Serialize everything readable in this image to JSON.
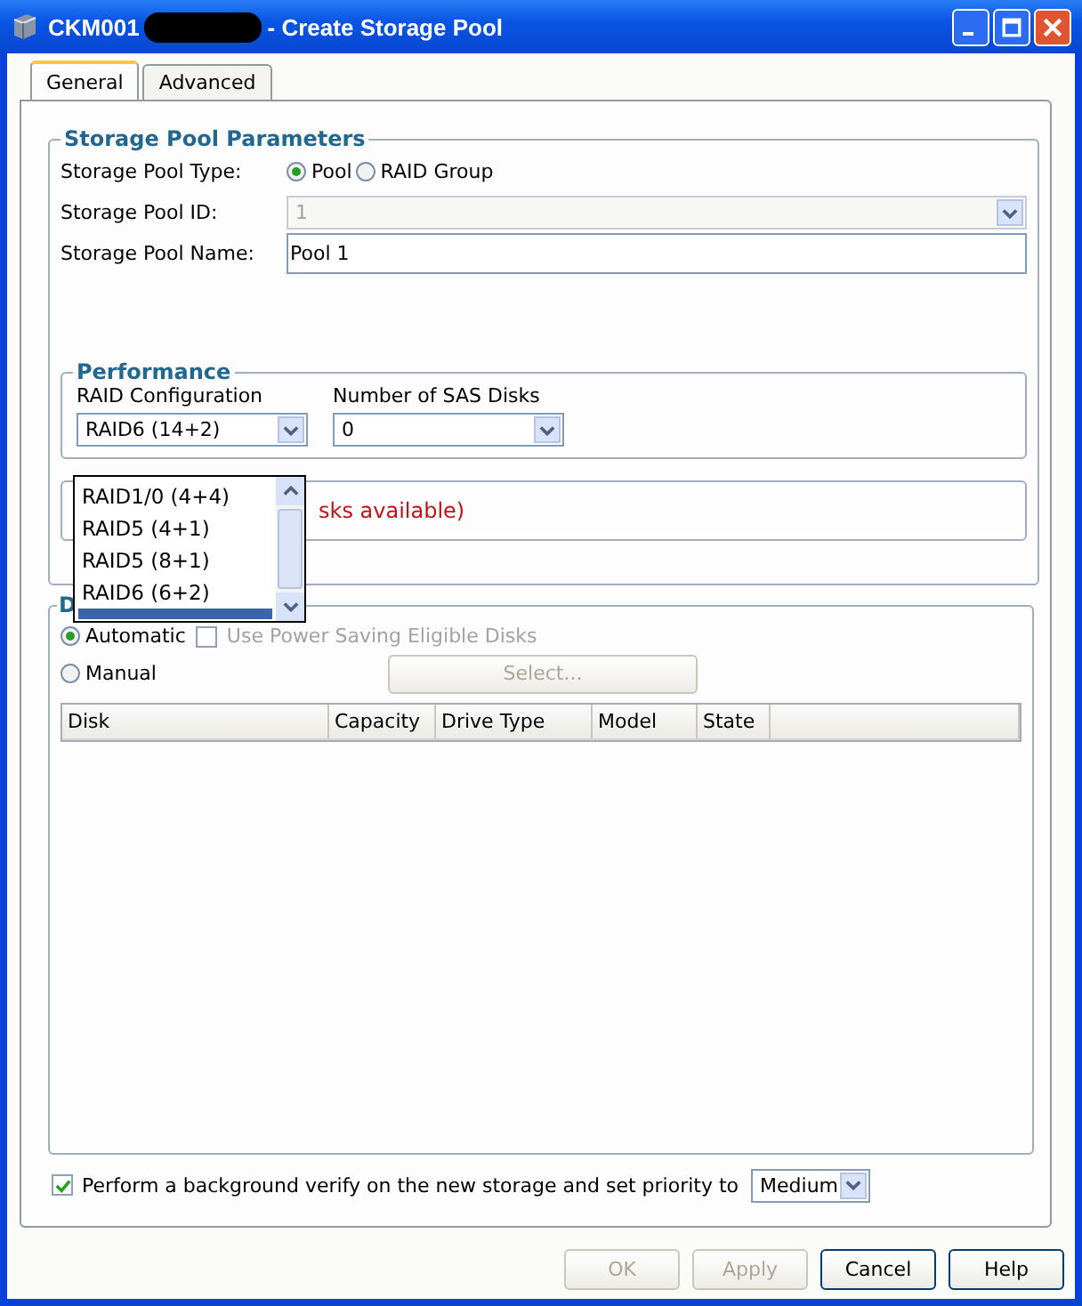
{
  "window": {
    "title_prefix": "CKM001",
    "title": "- Create Storage Pool",
    "redacted": true
  },
  "tabs": [
    {
      "label": "General",
      "selected": true
    },
    {
      "label": "Advanced",
      "selected": false
    }
  ],
  "parameters": {
    "legend": "Storage Pool Parameters",
    "type_label": "Storage Pool Type:",
    "type_options": [
      {
        "label": "Pool",
        "selected": true
      },
      {
        "label": "RAID Group",
        "selected": false
      }
    ],
    "id_label": "Storage Pool ID:",
    "id_value": "1",
    "id_disabled": true,
    "name_label": "Storage Pool Name:",
    "name_value": "Pool 1"
  },
  "performance": {
    "legend": "Performance",
    "raid_label": "RAID Configuration",
    "raid_value": "RAID6 (14+2)",
    "disks_label": "Number of SAS Disks",
    "disks_value": "0"
  },
  "availability": {
    "message": "sks available)"
  },
  "raid_dropdown": {
    "items": [
      {
        "label": "RAID1/0 (4+4)",
        "selected": false
      },
      {
        "label": "RAID5 (4+1)",
        "selected": false
      },
      {
        "label": "RAID5 (8+1)",
        "selected": false
      },
      {
        "label": "RAID6 (6+2)",
        "selected": false
      },
      {
        "selected": true
      }
    ]
  },
  "disks": {
    "legend": "D",
    "modes": [
      {
        "label": "Automatic",
        "selected": true
      },
      {
        "label": "Manual",
        "selected": false
      }
    ],
    "power_saving": {
      "label": "Use Power Saving Eligible Disks",
      "checked": false,
      "disabled": true
    },
    "select_button": {
      "label": "Select...",
      "disabled": true
    },
    "table": {
      "columns": [
        "Disk",
        "Capacity",
        "Drive Type",
        "Model",
        "State"
      ]
    }
  },
  "verify": {
    "label": "Perform a background verify on the new storage and set priority to",
    "checked": true,
    "priority": "Medium"
  },
  "buttons": [
    {
      "label": "OK",
      "disabled": true
    },
    {
      "label": "Apply",
      "disabled": true
    },
    {
      "label": "Cancel",
      "disabled": false
    },
    {
      "label": "Help",
      "disabled": false
    }
  ]
}
